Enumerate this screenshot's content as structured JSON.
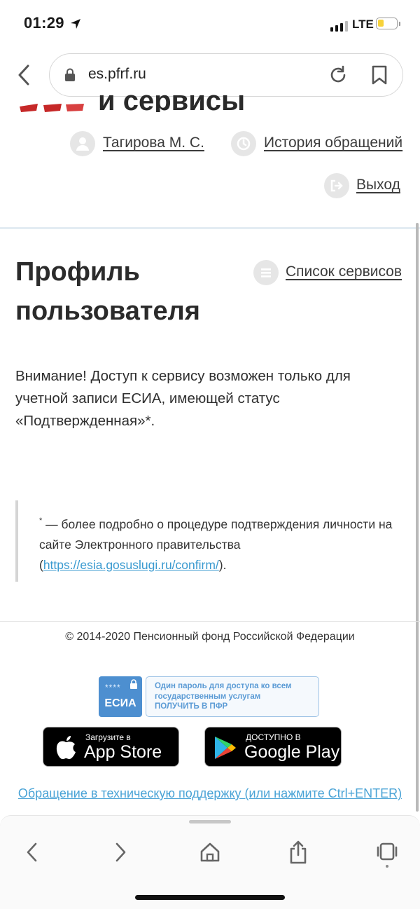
{
  "status_bar": {
    "time": "01:29",
    "network": "LTE"
  },
  "browser": {
    "url": "es.pfrf.ru"
  },
  "header": {
    "partial_title": "и сервисы ПФР",
    "user_name": "Тагирова М. С.",
    "history_link": "История обращений",
    "logout_link": "Выход"
  },
  "page": {
    "title": "Профиль пользователя",
    "services_link": "Список сервисов",
    "notice": "Внимание! Доступ к сервису возможен только для учетной записи ЕСИА, имеющей статус «Подтвержденная»*."
  },
  "note": {
    "marker": "*",
    "text": " — более подробно о процедуре подтверждения личности на сайте Электронного правительства (",
    "link": "https://esia.gosuslugi.ru/confirm/",
    "after": ")."
  },
  "footer": {
    "copyright": "© 2014-2020 Пенсионный фонд Российской Федерации",
    "esia_stars": "****",
    "esia_label": "ЕСИА",
    "esia_line1": "Один пароль для доступа ко всем",
    "esia_line2": "государственным услугам",
    "esia_line3": "ПОЛУЧИТЬ В ПФР",
    "appstore_small": "Загрузите в",
    "appstore_big": "App Store",
    "googleplay_small": "ДОСТУПНО В",
    "googleplay_big": "Google Play",
    "support_link": "Обращение в техническую поддержку (или нажмите Ctrl+ENTER)"
  },
  "colors": {
    "link_blue": "#3a9ad0",
    "esia_blue": "#4d8fd0",
    "battery_yellow": "#f7d23a"
  },
  "icons": [
    "location-arrow-icon",
    "signal-icon",
    "battery-icon",
    "back-icon",
    "lock-icon",
    "reload-icon",
    "bookmark-icon",
    "user-icon",
    "history-icon",
    "logout-icon",
    "list-icon",
    "apple-icon",
    "google-play-icon",
    "forward-icon",
    "home-icon",
    "share-icon",
    "tabs-icon"
  ]
}
